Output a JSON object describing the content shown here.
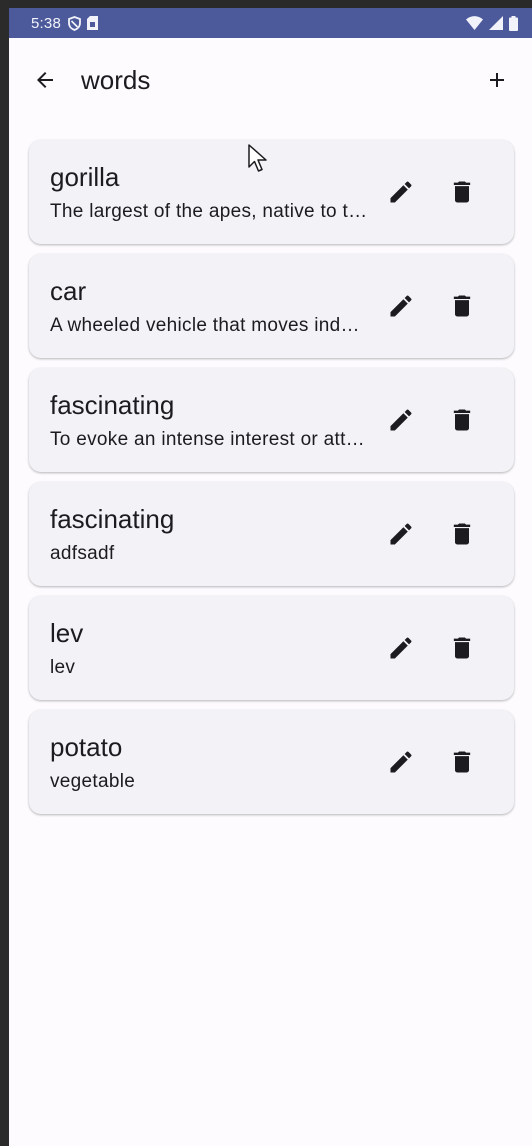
{
  "status_bar": {
    "time": "5:38",
    "background_color": "#4c5a9b",
    "icons_left": [
      "shield-icon",
      "sim-card-icon"
    ],
    "icons_right": [
      "wifi-icon",
      "signal-icon",
      "battery-icon"
    ]
  },
  "app_bar": {
    "title": "words",
    "back_icon": "arrow-left-icon",
    "add_icon": "plus-icon"
  },
  "words": [
    {
      "title": "gorilla",
      "description": "The largest of the apes, native to the forests of central Africa"
    },
    {
      "title": "car",
      "description": "A wheeled vehicle that moves independently"
    },
    {
      "title": "fascinating",
      "description": "To evoke an intense interest or attraction"
    },
    {
      "title": "fascinating",
      "description": "adfsadf"
    },
    {
      "title": "lev",
      "description": "lev"
    },
    {
      "title": "potato",
      "description": "vegetable"
    }
  ],
  "colors": {
    "screen_background": "#fdfbfe",
    "card_background": "#f3f3f7",
    "text": "#1c1b1f"
  },
  "card_icons": {
    "edit": "pencil-icon",
    "delete": "trash-icon"
  }
}
